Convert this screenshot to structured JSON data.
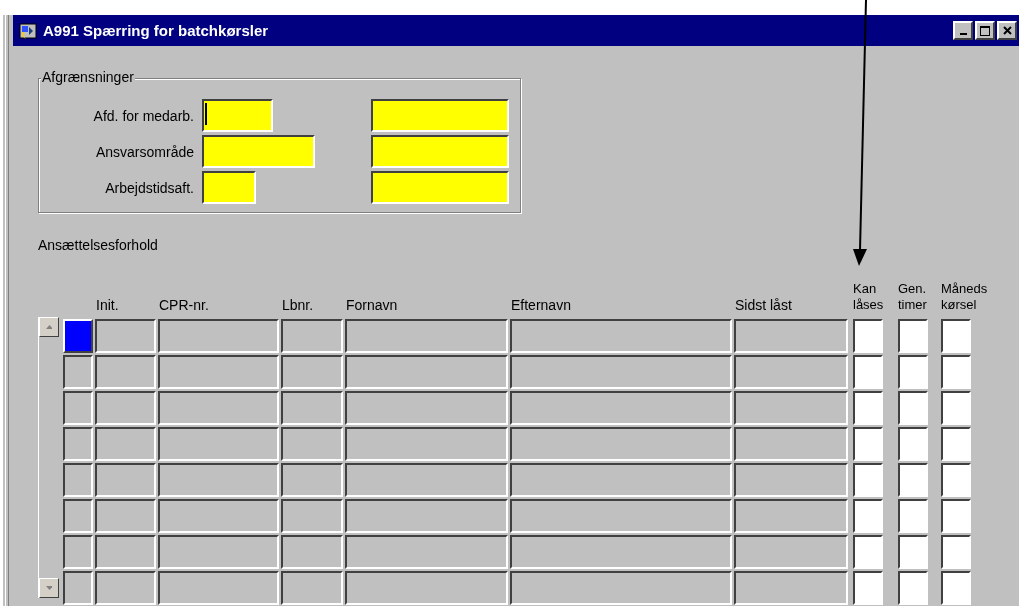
{
  "window": {
    "title": "A991 Spærring for batchkørsler"
  },
  "filters": {
    "title": "Afgrænsninger",
    "rows": [
      {
        "label": "Afd. for medarb.",
        "focused": true
      },
      {
        "label": "Ansvarsområde",
        "focused": false
      },
      {
        "label": "Arbejdstidsaft.",
        "focused": false
      }
    ]
  },
  "section_label": "Ansættelsesforhold",
  "table": {
    "columns": [
      {
        "label": "Init.",
        "kind": "text"
      },
      {
        "label": "CPR-nr.",
        "kind": "text"
      },
      {
        "label": "Lbnr.",
        "kind": "text"
      },
      {
        "label": "Fornavn",
        "kind": "text"
      },
      {
        "label": "Efternavn",
        "kind": "text"
      },
      {
        "label": "Sidst låst",
        "kind": "text"
      },
      {
        "label": "Kan låses",
        "kind": "check"
      },
      {
        "label": "Gen. timer",
        "kind": "check"
      },
      {
        "label": "Måneds kørsel",
        "kind": "check"
      }
    ],
    "rows": [
      {
        "selected": true
      },
      {
        "selected": false
      },
      {
        "selected": false
      },
      {
        "selected": false
      },
      {
        "selected": false
      },
      {
        "selected": false
      },
      {
        "selected": false
      },
      {
        "selected": false
      }
    ]
  }
}
